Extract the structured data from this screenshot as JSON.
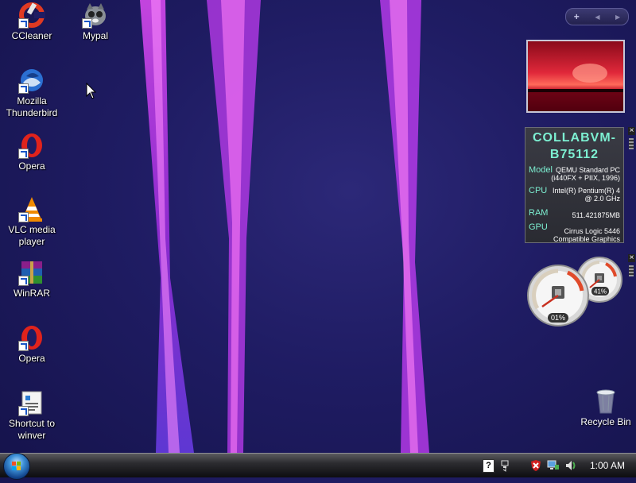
{
  "desktop": {
    "icons": [
      {
        "label": "CCleaner",
        "icon": "ccleaner-icon"
      },
      {
        "label": "Mypal",
        "icon": "mypal-icon"
      },
      {
        "label": "Mozilla\nThunderbird",
        "icon": "thunderbird-icon"
      },
      {
        "label": "Opera",
        "icon": "opera-icon"
      },
      {
        "label": "VLC media\nplayer",
        "icon": "vlc-icon"
      },
      {
        "label": "WinRAR",
        "icon": "winrar-icon"
      },
      {
        "label": "Opera",
        "icon": "opera-icon"
      },
      {
        "label": "Shortcut to\nwinver",
        "icon": "winver-icon"
      }
    ],
    "recycle_bin": {
      "label": "Recycle Bin"
    }
  },
  "sidebar": {
    "controls": {
      "add": "+",
      "prev": "◀",
      "next": "▶"
    }
  },
  "system_info": {
    "computer_name": "COLLABVM-B75112",
    "model_label": "Model",
    "model_value": "QEMU Standard PC (i440FX + PIIX, 1996)",
    "cpu_label": "CPU",
    "cpu_value": "Intel(R) Pentium(R) 4 @ 2.0 GHz",
    "ram_label": "RAM",
    "ram_value": "511.421875MB",
    "gpu_label": "GPU",
    "gpu_value": "Cirrus Logic 5446 Compatible Graphics"
  },
  "cpu_meter": {
    "cpu_percent": "01%",
    "memory_percent": "41%"
  },
  "taskbar": {
    "clock": "1:00 AM"
  },
  "colors": {
    "accent": "#7df0d2",
    "wallpaper": "#1f1c63",
    "beam": "#c23cf0"
  }
}
